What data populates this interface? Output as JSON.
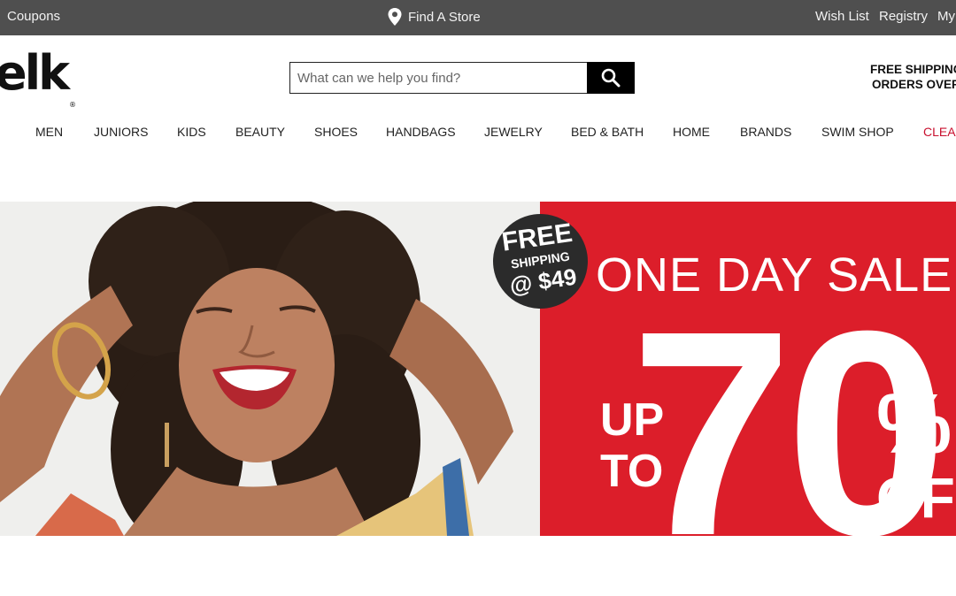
{
  "topbar": {
    "coupons": "Coupons",
    "find_store": "Find A Store",
    "wish_list": "Wish List",
    "registry": "Registry",
    "my": "My"
  },
  "header": {
    "logo_text": "elk",
    "search_placeholder": "What can we help you find?",
    "shipping_line1": "FREE SHIPPING",
    "shipping_line2": "ORDERS OVER $"
  },
  "nav": {
    "items": [
      "MEN",
      "JUNIORS",
      "KIDS",
      "BEAUTY",
      "SHOES",
      "HANDBAGS",
      "JEWELRY",
      "BED & BATH",
      "HOME",
      "BRANDS",
      "SWIM SHOP",
      "CLEAR"
    ]
  },
  "hero": {
    "badge_line1": "FREE",
    "badge_line2": "SHIPPING",
    "badge_line3": "@ $49",
    "headline": "ONE DAY SALE",
    "up": "UP",
    "to": "TO",
    "number": "70",
    "percent": "%",
    "off": "OFF"
  },
  "colors": {
    "topbar_bg": "#4f4f4f",
    "sale_red": "#dc1e2a",
    "clearance_red": "#c8102e",
    "badge_bg": "#2b2b2b"
  }
}
